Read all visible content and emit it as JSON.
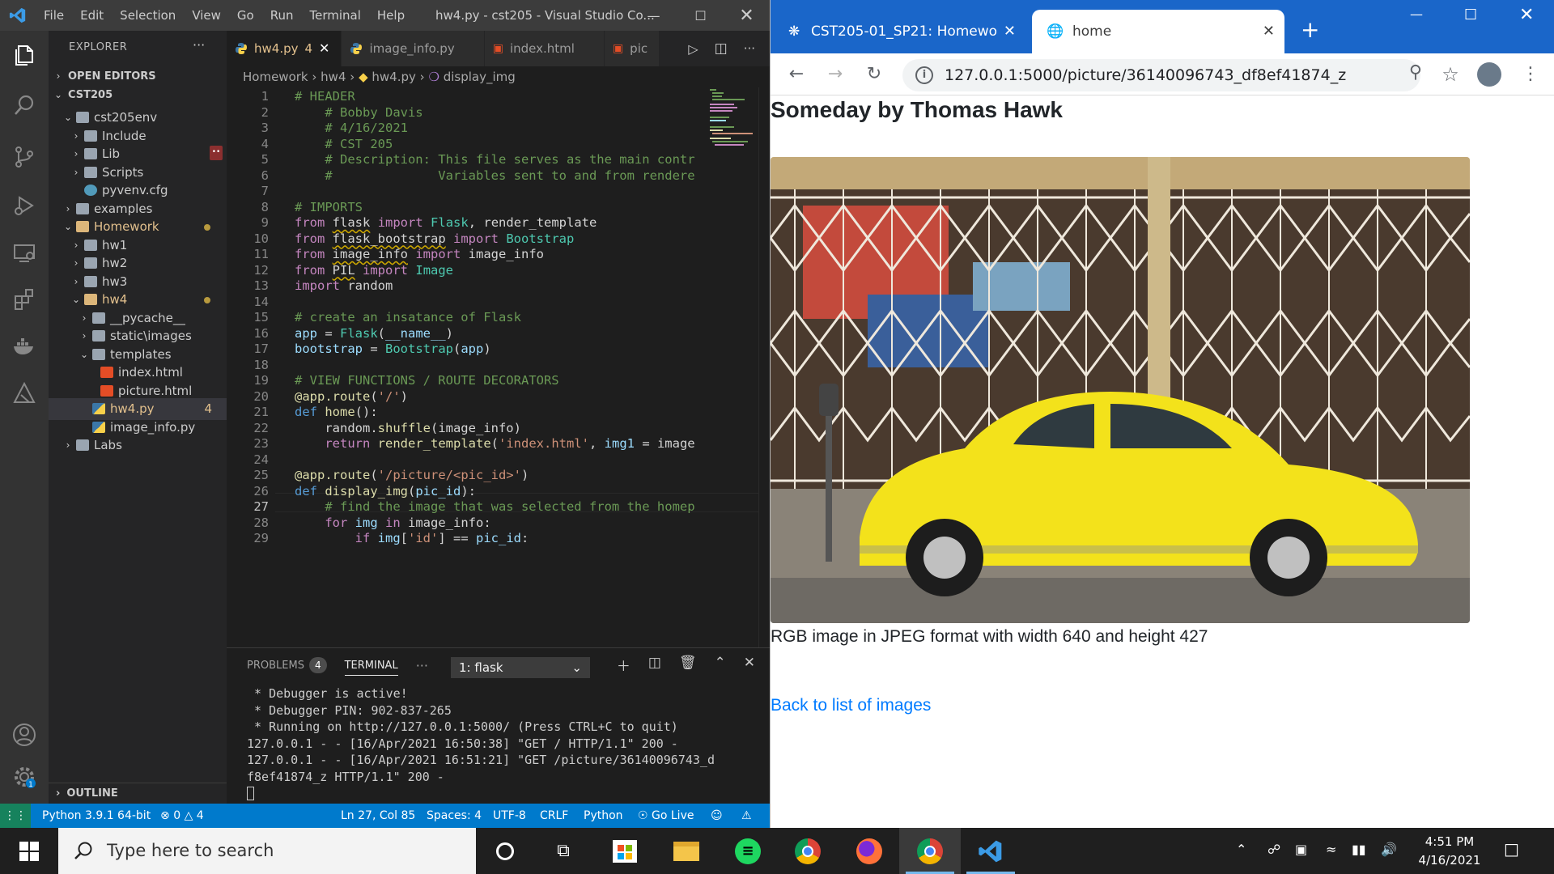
{
  "vscode": {
    "menu": [
      "File",
      "Edit",
      "Selection",
      "View",
      "Go",
      "Run",
      "Terminal",
      "Help"
    ],
    "window_title": "hw4.py - cst205 - Visual Studio Co...",
    "explorer": {
      "title": "EXPLORER",
      "open_editors": "OPEN EDITORS",
      "root": "CST205",
      "tree": [
        {
          "label": "cst205env",
          "depth": 1,
          "chev": "v"
        },
        {
          "label": "Include",
          "depth": 2,
          "chev": ">"
        },
        {
          "label": "Lib",
          "depth": 2,
          "chev": ">"
        },
        {
          "label": "Scripts",
          "depth": 2,
          "chev": ">"
        },
        {
          "label": "pyvenv.cfg",
          "depth": 2,
          "chev": ""
        },
        {
          "label": "examples",
          "depth": 1,
          "chev": ">"
        },
        {
          "label": "Homework",
          "depth": 1,
          "chev": "v"
        },
        {
          "label": "hw1",
          "depth": 2,
          "chev": ">"
        },
        {
          "label": "hw2",
          "depth": 2,
          "chev": ">"
        },
        {
          "label": "hw3",
          "depth": 2,
          "chev": ">"
        },
        {
          "label": "hw4",
          "depth": 2,
          "chev": "v"
        },
        {
          "label": "__pycache__",
          "depth": 3,
          "chev": ">"
        },
        {
          "label": "static\\images",
          "depth": 3,
          "chev": ">"
        },
        {
          "label": "templates",
          "depth": 3,
          "chev": "v"
        },
        {
          "label": "index.html",
          "depth": 4,
          "chev": ""
        },
        {
          "label": "picture.html",
          "depth": 4,
          "chev": ""
        },
        {
          "label": "hw4.py",
          "depth": 3,
          "chev": ""
        },
        {
          "label": "image_info.py",
          "depth": 3,
          "chev": ""
        },
        {
          "label": "Labs",
          "depth": 1,
          "chev": ">"
        }
      ],
      "hw4_problem_count": "4",
      "outline": "OUTLINE"
    },
    "tabs": [
      {
        "label": "hw4.py",
        "badge": "4"
      },
      {
        "label": "image_info.py"
      },
      {
        "label": "index.html"
      },
      {
        "label": "pic"
      }
    ],
    "breadcrumb": [
      "Homework",
      "hw4",
      "hw4.py",
      "display_img"
    ],
    "line_numbers": [
      "1",
      "2",
      "3",
      "4",
      "5",
      "6",
      "7",
      "8",
      "9",
      "10",
      "11",
      "12",
      "13",
      "14",
      "15",
      "16",
      "17",
      "18",
      "19",
      "20",
      "21",
      "22",
      "23",
      "24",
      "25",
      "26",
      "27",
      "28",
      "29"
    ],
    "current_line": "27",
    "panel": {
      "problems": "PROBLEMS",
      "problems_count": "4",
      "terminal": "TERMINAL",
      "more": "···",
      "terminal_select": "1: flask",
      "output": [
        " * Debugger is active!",
        " * Debugger PIN: 902-837-265",
        " * Running on http://127.0.0.1:5000/ (Press CTRL+C to quit)",
        "127.0.0.1 - - [16/Apr/2021 16:50:38] \"GET / HTTP/1.1\" 200 -",
        "127.0.0.1 - - [16/Apr/2021 16:51:21] \"GET /picture/36140096743_d",
        "f8ef41874_z HTTP/1.1\" 200 -"
      ]
    },
    "status": {
      "interpreter": "Python 3.9.1 64-bit",
      "errors": "0",
      "warnings": "4",
      "position": "Ln 27, Col 85",
      "spaces": "Spaces: 4",
      "encoding": "UTF-8",
      "eol": "CRLF",
      "language": "Python",
      "golive": "Go Live"
    }
  },
  "chrome": {
    "tabs": [
      {
        "label": "CST205-01_SP21: Homewo"
      },
      {
        "label": "home"
      }
    ],
    "url": "127.0.0.1:5000/picture/36140096743_df8ef41874_z",
    "page": {
      "heading": "Someday by Thomas Hawk",
      "caption": "RGB image in JPEG format with width 640 and height 427",
      "back_link": "Back to list of images"
    }
  },
  "taskbar": {
    "search_placeholder": "Type here to search",
    "time": "4:51 PM",
    "date": "4/16/2021"
  },
  "colors": {
    "vscode_accent": "#007acc",
    "chrome_tabstrip": "#1a66c9",
    "link": "#007bff",
    "car_yellow": "#f3e21b"
  }
}
